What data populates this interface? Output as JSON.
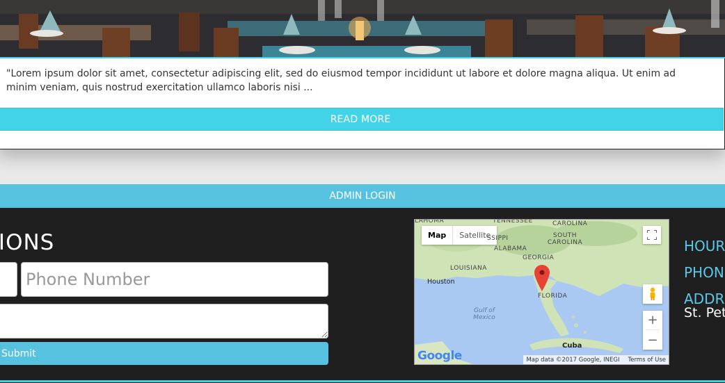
{
  "post": {
    "excerpt": "\"Lorem ipsum dolor sit amet, consectetur adipiscing elit, sed do eiusmod tempor incididunt ut labore et dolore magna aliqua. Ut enim ad minim veniam, quis nostrud exercitation ullamco laboris nisi ...",
    "read_more_label": "READ MORE"
  },
  "admin": {
    "login_label": "ADMIN LOGIN"
  },
  "reservations": {
    "title_partial": "TIONS",
    "phone_placeholder": "Phone Number",
    "submit_label": "Submit"
  },
  "map": {
    "type_map": "Map",
    "type_satellite": "Satellite",
    "labels": {
      "tennessee": "TENNESSEE",
      "north_carolina": "CAROLINA",
      "oklahoma": "LAHOMA",
      "mississippi": "SSIPPI",
      "south_carolina": "SOUTH CAROLINA",
      "alabama": "ALABAMA",
      "georgia": "GEORGIA",
      "louisiana": "LOUISIANA",
      "houston": "Houston",
      "florida": "FLORIDA",
      "gulf": "Gulf of Mexico",
      "cuba": "Cuba"
    },
    "logo": "Google",
    "attribution": "Map data ©2017 Google, INEGI",
    "terms": "Terms of Use",
    "zoom_in": "+",
    "zoom_out": "−"
  },
  "info": {
    "hours_label": "HOUR",
    "phone_label": "PHON",
    "address_label": "ADDR",
    "address_value": "St. Pet"
  },
  "colors": {
    "accent": "#43d3e8",
    "button": "#57c2e0",
    "dark_bg": "#1f1f1f",
    "info_label": "#5ac8e6"
  },
  "icons": {
    "fullscreen": "fullscreen-icon",
    "pegman": "pegman-icon",
    "marker": "map-marker-icon"
  }
}
